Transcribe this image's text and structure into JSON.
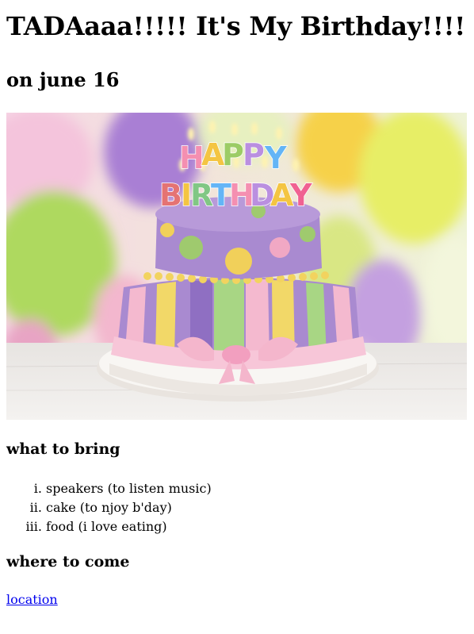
{
  "heading": {
    "title": "TADAaaa!!!!! It's My Birthday!!!!",
    "date": "on june 16"
  },
  "hero_image": {
    "cake_letters_top": "HAPPY",
    "cake_letters_bottom": "BIRTHDAY",
    "colors": {
      "cake_purple": "#a98ad0",
      "cake_purple_dark": "#8f6fc2",
      "stripe_yellow": "#f2d868",
      "stripe_green": "#a8d684",
      "stripe_pink": "#f4b9cf",
      "ribbon_pink": "#f7c6d8",
      "dot_green": "#9fca6e",
      "dot_yellow": "#f1d05a",
      "dot_pink": "#f1a8c4",
      "plate": "#f6f3ef",
      "table": "#ece9e6"
    }
  },
  "bring_section": {
    "title": "what to bring",
    "items": [
      "speakers (to listen music)",
      "cake (to njoy b'day)",
      "food (i love eating)"
    ]
  },
  "come_section": {
    "title": "where to come",
    "link_label": "location"
  }
}
